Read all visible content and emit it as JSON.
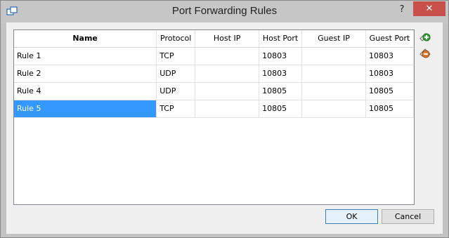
{
  "window": {
    "title": "Port Forwarding Rules",
    "help_glyph": "?",
    "close_glyph": "✕"
  },
  "table": {
    "columns": [
      "Name",
      "Protocol",
      "Host IP",
      "Host Port",
      "Guest IP",
      "Guest Port"
    ],
    "rows": [
      {
        "name": "Rule 1",
        "protocol": "TCP",
        "host_ip": "",
        "host_port": "10803",
        "guest_ip": "",
        "guest_port": "10803"
      },
      {
        "name": "Rule 2",
        "protocol": "UDP",
        "host_ip": "",
        "host_port": "10803",
        "guest_ip": "",
        "guest_port": "10803"
      },
      {
        "name": "Rule 4",
        "protocol": "UDP",
        "host_ip": "",
        "host_port": "10805",
        "guest_ip": "",
        "guest_port": "10805"
      },
      {
        "name": "Rule 5",
        "protocol": "TCP",
        "host_ip": "",
        "host_port": "10805",
        "guest_ip": "",
        "guest_port": "10805"
      }
    ],
    "selected_row": 3
  },
  "tools": {
    "add_icon": "add-rule-icon",
    "remove_icon": "remove-rule-icon"
  },
  "buttons": {
    "ok": "OK",
    "cancel": "Cancel"
  },
  "colors": {
    "selection": "#3399ff",
    "close_button": "#c7504a"
  }
}
